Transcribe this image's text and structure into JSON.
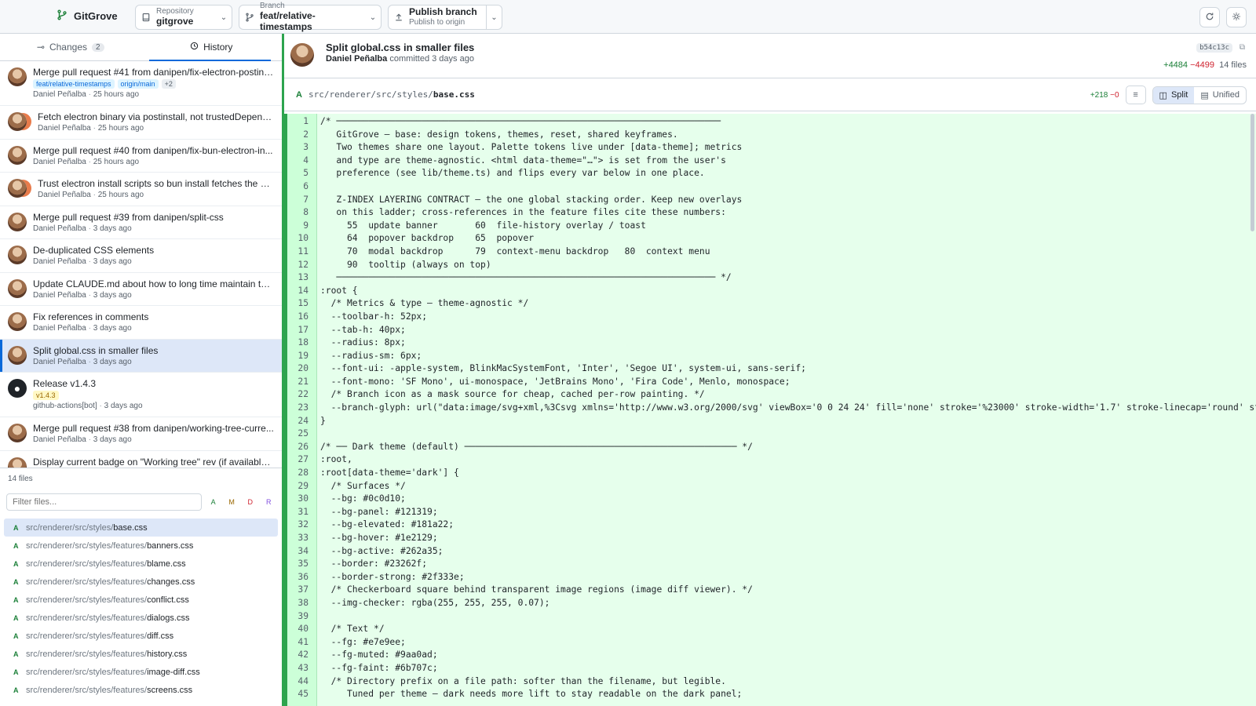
{
  "app": {
    "name": "GitGrove"
  },
  "toolbar": {
    "repository_label": "Repository",
    "repository_value": "gitgrove",
    "branch_label": "Branch",
    "branch_value": "feat/relative-timestamps",
    "publish_title": "Publish branch",
    "publish_sub": "Publish to origin"
  },
  "tabs": {
    "changes": "Changes",
    "changes_count": "2",
    "history": "History"
  },
  "commits": [
    {
      "title": "Merge pull request #41 from danipen/fix-electron-postins...",
      "author": "Daniel Peñalba",
      "time": "25 hours ago",
      "tags": [
        "feat/relative-timestamps",
        "origin/main",
        "+2"
      ]
    },
    {
      "title": "Fetch electron binary via postinstall, not trustedDepend...",
      "author": "Daniel Peñalba",
      "time": "25 hours ago"
    },
    {
      "title": "Merge pull request #40 from danipen/fix-bun-electron-in...",
      "author": "Daniel Peñalba",
      "time": "25 hours ago"
    },
    {
      "title": "Trust electron install scripts so bun install fetches the bi...",
      "author": "Daniel Peñalba",
      "time": "25 hours ago"
    },
    {
      "title": "Merge pull request #39 from danipen/split-css",
      "author": "Daniel Peñalba",
      "time": "3 days ago"
    },
    {
      "title": "De-duplicated CSS elements",
      "author": "Daniel Peñalba",
      "time": "3 days ago"
    },
    {
      "title": "Update CLAUDE.md about how to long time maintain the ...",
      "author": "Daniel Peñalba",
      "time": "3 days ago"
    },
    {
      "title": "Fix references in comments",
      "author": "Daniel Peñalba",
      "time": "3 days ago"
    },
    {
      "title": "Split global.css in smaller files",
      "author": "Daniel Peñalba",
      "time": "3 days ago"
    },
    {
      "title": "Release v1.4.3",
      "author": "github-actions[bot]",
      "time": "3 days ago",
      "tags": [
        "v1.4.3"
      ]
    },
    {
      "title": "Merge pull request #38 from danipen/working-tree-curre...",
      "author": "Daniel Peñalba",
      "time": "3 days ago"
    },
    {
      "title": "Display current badge on \"Working tree\" rev (if available)...",
      "author": "",
      "time": ""
    }
  ],
  "files": {
    "count_label": "14 files",
    "filter_placeholder": "Filter files...",
    "filters": [
      "A",
      "M",
      "D",
      "R"
    ],
    "items": [
      {
        "status": "A",
        "dir": "src/renderer/src/styles/",
        "name": "base.css"
      },
      {
        "status": "A",
        "dir": "src/renderer/src/styles/features/",
        "name": "banners.css"
      },
      {
        "status": "A",
        "dir": "src/renderer/src/styles/features/",
        "name": "blame.css"
      },
      {
        "status": "A",
        "dir": "src/renderer/src/styles/features/",
        "name": "changes.css"
      },
      {
        "status": "A",
        "dir": "src/renderer/src/styles/features/",
        "name": "conflict.css"
      },
      {
        "status": "A",
        "dir": "src/renderer/src/styles/features/",
        "name": "dialogs.css"
      },
      {
        "status": "A",
        "dir": "src/renderer/src/styles/features/",
        "name": "diff.css"
      },
      {
        "status": "A",
        "dir": "src/renderer/src/styles/features/",
        "name": "history.css"
      },
      {
        "status": "A",
        "dir": "src/renderer/src/styles/features/",
        "name": "image-diff.css"
      },
      {
        "status": "A",
        "dir": "src/renderer/src/styles/features/",
        "name": "screens.css"
      }
    ]
  },
  "commit_header": {
    "title": "Split global.css in smaller files",
    "author": "Daniel Peñalba",
    "committed": "committed 3 days ago",
    "sha": "b54c13c",
    "additions": "+4484",
    "deletions": "−4499",
    "files": "14 files"
  },
  "file_header": {
    "status": "A",
    "dir": "src/renderer/src/styles/",
    "name": "base.css",
    "additions": "+218",
    "deletions": "−0",
    "split_label": "Split",
    "unified_label": "Unified"
  },
  "code_lines": [
    "/* ────────────────────────────────────────────────────────────────────────",
    "   GitGrove — base: design tokens, themes, reset, shared keyframes.",
    "   Two themes share one layout. Palette tokens live under [data-theme]; metrics",
    "   and type are theme-agnostic. <html data-theme=\"…\"> is set from the user's",
    "   preference (see lib/theme.ts) and flips every var below in one place.",
    "",
    "   Z-INDEX LAYERING CONTRACT — the one global stacking order. Keep new overlays",
    "   on this ladder; cross-references in the feature files cite these numbers:",
    "     55  update banner       60  file-history overlay / toast",
    "     64  popover backdrop    65  popover",
    "     70  modal backdrop      79  context-menu backdrop   80  context menu",
    "     90  tooltip (always on top)",
    "   ─────────────────────────────────────────────────────────────────────── */",
    ":root {",
    "  /* Metrics & type — theme-agnostic */",
    "  --toolbar-h: 52px;",
    "  --tab-h: 40px;",
    "  --radius: 8px;",
    "  --radius-sm: 6px;",
    "  --font-ui: -apple-system, BlinkMacSystemFont, 'Inter', 'Segoe UI', system-ui, sans-serif;",
    "  --font-mono: 'SF Mono', ui-monospace, 'JetBrains Mono', 'Fira Code', Menlo, monospace;",
    "  /* Branch icon as a mask source for cheap, cached per-row painting. */",
    "  --branch-glyph: url(\"data:image/svg+xml,%3Csvg xmlns='http://www.w3.org/2000/svg' viewBox='0 0 24 24' fill='none' stroke='%23000' stroke-width='1.7' stroke-linecap='round' stroke-",
    "}",
    "",
    "/* ── Dark theme (default) ─────────────────────────────────────────────────── */",
    ":root,",
    ":root[data-theme='dark'] {",
    "  /* Surfaces */",
    "  --bg: #0c0d10;",
    "  --bg-panel: #121319;",
    "  --bg-elevated: #181a22;",
    "  --bg-hover: #1e2129;",
    "  --bg-active: #262a35;",
    "  --border: #23262f;",
    "  --border-strong: #2f333e;",
    "  /* Checkerboard square behind transparent image regions (image diff viewer). */",
    "  --img-checker: rgba(255, 255, 255, 0.07);",
    "",
    "  /* Text */",
    "  --fg: #e7e9ee;",
    "  --fg-muted: #9aa0ad;",
    "  --fg-faint: #6b707c;",
    "  /* Directory prefix on a file path: softer than the filename, but legible.",
    "     Tuned per theme — dark needs more lift to stay readable on the dark panel;"
  ],
  "colors": {
    "accent": "#0969da",
    "added": "#1a7f37",
    "deleted": "#cf222e",
    "added_bg": "#e6ffec",
    "selection": "#dde7f8"
  }
}
